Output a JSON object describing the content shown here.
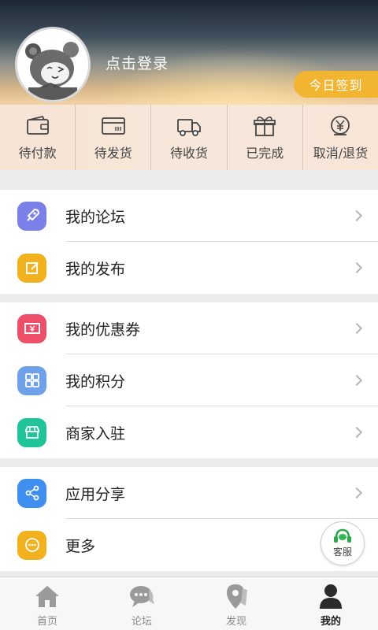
{
  "header": {
    "login_text": "点击登录",
    "checkin_label": "今日签到"
  },
  "orders": [
    {
      "label": "待付款",
      "icon": "wallet-icon"
    },
    {
      "label": "待发货",
      "icon": "card-icon"
    },
    {
      "label": "待收货",
      "icon": "truck-icon"
    },
    {
      "label": "已完成",
      "icon": "gift-icon"
    },
    {
      "label": "取消/退货",
      "icon": "yen-return-icon"
    }
  ],
  "menu": {
    "forum": {
      "label": "我的论坛",
      "icon": "rocket-icon",
      "color": "#7b7fe8"
    },
    "publish": {
      "label": "我的发布",
      "icon": "edit-icon",
      "color": "#f2b11f"
    },
    "coupons": {
      "label": "我的优惠券",
      "icon": "coupon-icon",
      "color": "#ee4f68"
    },
    "points": {
      "label": "我的积分",
      "icon": "grid-icon",
      "color": "#6fa0ea"
    },
    "merchant": {
      "label": "商家入驻",
      "icon": "shop-icon",
      "color": "#1fc49a"
    },
    "share": {
      "label": "应用分享",
      "icon": "share-icon",
      "color": "#3f8ff1"
    },
    "more": {
      "label": "更多",
      "icon": "more-icon",
      "color": "#f2b11f"
    }
  },
  "kefu_label": "客服",
  "tabs": [
    {
      "label": "首页",
      "icon": "home-icon",
      "active": false
    },
    {
      "label": "论坛",
      "icon": "chat-icon",
      "active": false
    },
    {
      "label": "发现",
      "icon": "location-icon",
      "active": false
    },
    {
      "label": "我的",
      "icon": "user-icon",
      "active": true
    }
  ]
}
